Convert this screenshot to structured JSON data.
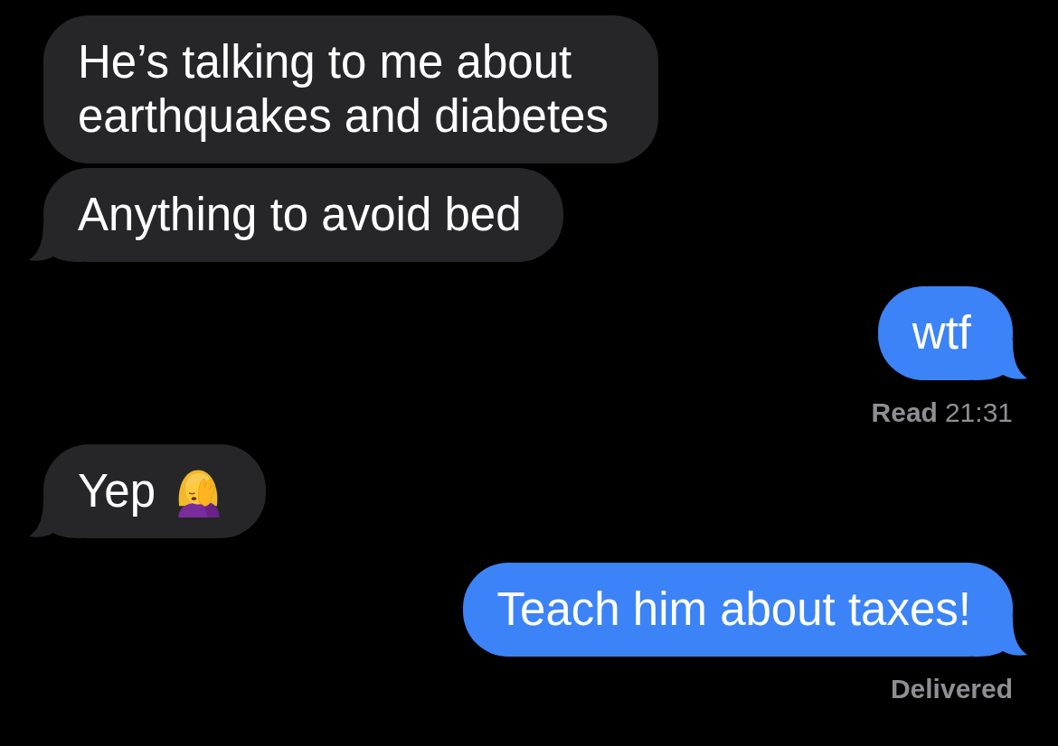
{
  "messages": [
    {
      "kind": "received",
      "text": "He’s talking to me about earthquakes and diabetes",
      "tail": false
    },
    {
      "kind": "received",
      "text": "Anything to avoid bed",
      "tail": true
    },
    {
      "kind": "sent",
      "text": "wtf",
      "tail": true,
      "receipt": {
        "status": "Read",
        "time": "21:31"
      }
    },
    {
      "kind": "received",
      "text": "Yep",
      "emoji": true,
      "tail": true
    },
    {
      "kind": "sent",
      "text": "Teach him about taxes!",
      "tail": true,
      "receipt": {
        "status": "Delivered"
      }
    }
  ]
}
